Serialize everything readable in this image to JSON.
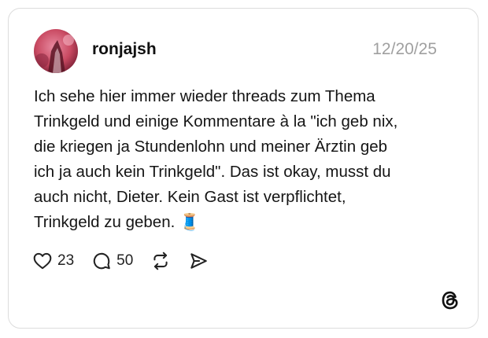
{
  "post": {
    "username": "ronjajsh",
    "date": "12/20/25",
    "text": "Ich sehe hier immer wieder threads zum Thema\nTrinkgeld und einige Kommentare à la \"ich geb nix,\ndie kriegen ja Stundenlohn und meiner Ärztin geb\nich ja auch kein Trinkgeld\". Das ist okay, musst du\nauch nicht, Dieter. Kein Gast ist verpflichtet,\nTrinkgeld zu geben. 🧵"
  },
  "actions": {
    "likes": "23",
    "replies": "50",
    "like_icon": "heart-icon",
    "reply_icon": "comment-bubble-icon",
    "repost_icon": "repost-icon",
    "share_icon": "share-send-icon"
  },
  "branding": {
    "logo_icon": "threads-logo-icon"
  },
  "colors": {
    "text": "#151515",
    "date": "#a0a0a0",
    "border": "#dcdcdc",
    "avatar_bg": "#c94a62"
  }
}
